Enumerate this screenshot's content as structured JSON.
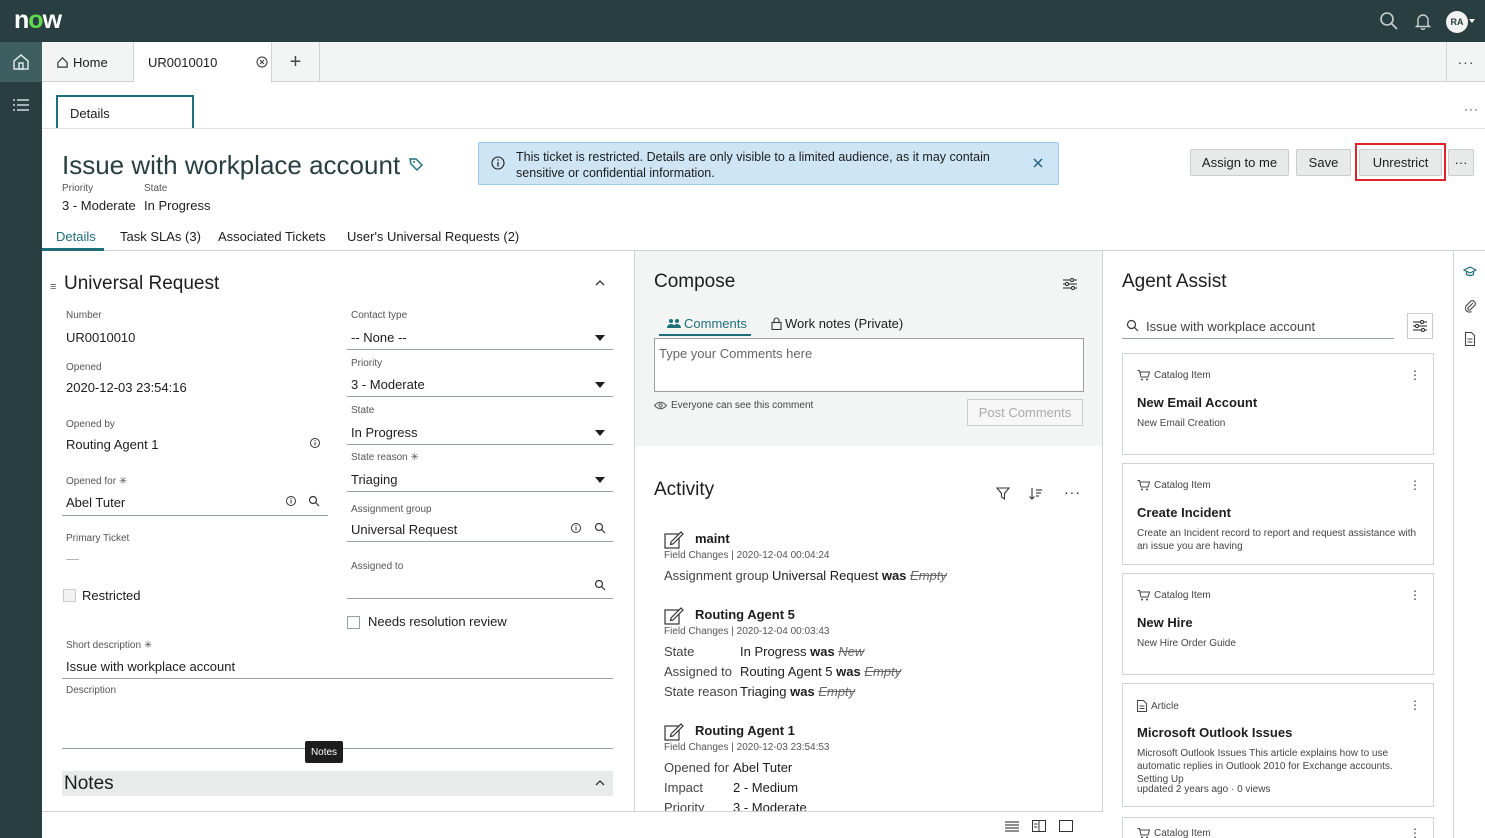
{
  "topbar": {
    "logo": "now",
    "avatar": "RA",
    "icons": [
      "search-icon",
      "bell-icon",
      "avatar"
    ]
  },
  "tabs": {
    "home": "Home",
    "record": "UR0010010",
    "add": "+"
  },
  "subbar": {
    "details": "Details"
  },
  "record": {
    "title": "Issue with workplace account",
    "priority_label": "Priority",
    "priority_value": "3 - Moderate",
    "state_label": "State",
    "state_value": "In Progress"
  },
  "banner": {
    "text": "This ticket is restricted. Details are only visible to a limited audience, as it may contain sensitive or confidential information.",
    "color": "#cde5f4"
  },
  "header_buttons": {
    "assign": "Assign to me",
    "save": "Save",
    "unrestrict": "Unrestrict",
    "more": "···"
  },
  "record_tabs": [
    "Details",
    "Task SLAs (3)",
    "Associated Tickets",
    "User's Universal Requests (2)"
  ],
  "form": {
    "section_title": "Universal Request",
    "number_label": "Number",
    "number_value": "UR0010010",
    "opened_label": "Opened",
    "opened_value": "2020-12-03 23:54:16",
    "opened_by_label": "Opened by",
    "opened_by_value": "Routing Agent 1",
    "opened_for_label": "Opened for ✳",
    "opened_for_value": "Abel Tuter",
    "primary_ticket_label": "Primary Ticket",
    "primary_ticket_value": "—",
    "restricted_label": "Restricted",
    "contact_type_label": "Contact type",
    "contact_type_value": "-- None --",
    "priority_label": "Priority",
    "priority_value": "3 - Moderate",
    "state_label": "State",
    "state_value": "In Progress",
    "state_reason_label": "State reason ✳",
    "state_reason_value": "Triaging",
    "assignment_group_label": "Assignment group",
    "assignment_group_value": "Universal Request",
    "assigned_to_label": "Assigned to",
    "needs_review_label": "Needs resolution review",
    "short_desc_label": "Short description ✳",
    "short_desc_value": "Issue with workplace account",
    "description_label": "Description",
    "notes_title": "Notes",
    "notes_tooltip": "Notes"
  },
  "compose": {
    "title": "Compose",
    "tab_comments": "Comments",
    "tab_worknotes": "Work notes (Private)",
    "placeholder": "Type your Comments here",
    "visibility": "Everyone can see this comment",
    "post_button": "Post Comments"
  },
  "activity": {
    "title": "Activity",
    "entries": [
      {
        "author": "maint",
        "sub": "Field Changes | 2020-12-04 00:04:24",
        "changes": [
          {
            "label": "Assignment group",
            "value": "Universal Request",
            "was": "was",
            "old": "Empty"
          }
        ]
      },
      {
        "author": "Routing Agent 5",
        "sub": "Field Changes | 2020-12-04 00:03:43",
        "changes": [
          {
            "label": "State",
            "value": "In Progress",
            "was": "was",
            "old": "New"
          },
          {
            "label": "Assigned to",
            "value": "Routing Agent 5",
            "was": "was",
            "old": "Empty"
          },
          {
            "label": "State reason",
            "value": "Triaging",
            "was": "was",
            "old": "Empty"
          }
        ]
      },
      {
        "author": "Routing Agent 1",
        "sub": "Field Changes | 2020-12-03 23:54:53",
        "changes": [
          {
            "label": "Opened for",
            "value": "Abel Tuter"
          },
          {
            "label": "Impact",
            "value": "2 - Medium"
          },
          {
            "label": "Priority",
            "value": "3 - Moderate"
          }
        ]
      }
    ]
  },
  "agent_assist": {
    "title": "Agent Assist",
    "search_value": "Issue with workplace account",
    "cards": [
      {
        "type": "Catalog Item",
        "title": "New Email Account",
        "desc": "New Email Creation",
        "foot": ""
      },
      {
        "type": "Catalog Item",
        "title": "Create Incident",
        "desc": "Create an Incident record to report and request assistance with an issue you are having",
        "foot": ""
      },
      {
        "type": "Catalog Item",
        "title": "New Hire",
        "desc": "New Hire Order Guide",
        "foot": ""
      },
      {
        "type": "Article",
        "title": "Microsoft Outlook Issues",
        "desc": "Microsoft Outlook Issues This article explains how to use automatic replies in Outlook 2010 for Exchange accounts. Setting Up",
        "foot": "updated 2 years ago · 0 views"
      },
      {
        "type": "Catalog Item",
        "title": "",
        "desc": "",
        "foot": ""
      }
    ]
  },
  "colors": {
    "topbar": "#293e40",
    "accent": "#1f6f7a",
    "highlight": "#e0242a",
    "logo_accent": "#62d84e"
  }
}
